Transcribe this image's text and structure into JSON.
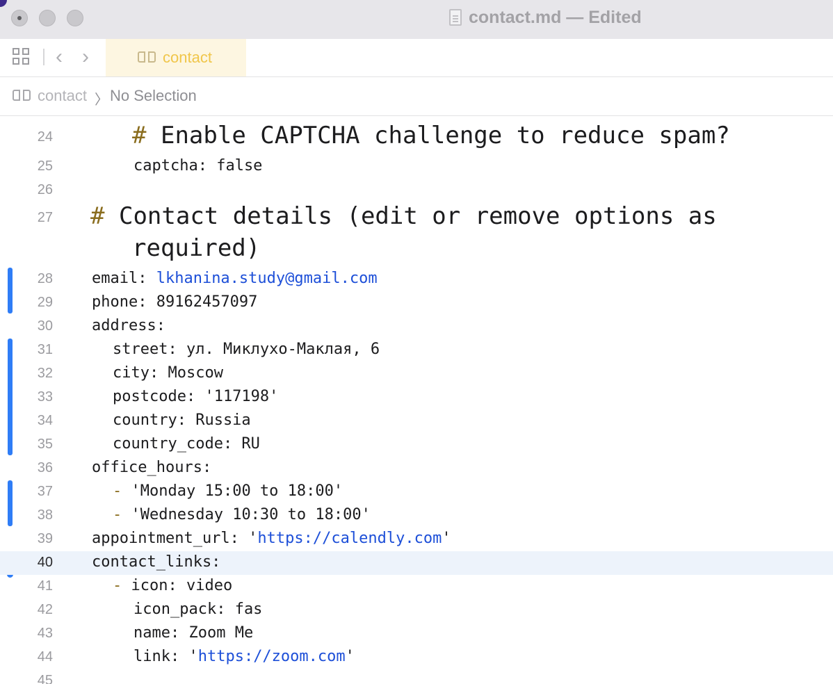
{
  "window": {
    "title": "contact.md — Edited",
    "controls": [
      "close",
      "minimize",
      "zoom"
    ]
  },
  "toolbar": {
    "tab_label": "contact",
    "tab_icon": "book-icon",
    "back_icon": "chevron-left-icon",
    "forward_icon": "chevron-right-icon",
    "layout_icon": "grid-icon"
  },
  "jumpbar": {
    "file": "contact",
    "separator": "〉",
    "selection": "No Selection"
  },
  "editor": {
    "lines": [
      {
        "num": "24",
        "text": "Enable CAPTCHA challenge to reduce spam?"
      },
      {
        "num": "25",
        "text": "captcha: false"
      },
      {
        "num": "26",
        "text": ""
      },
      {
        "num": "27",
        "text": "Contact details (edit or remove options as"
      },
      {
        "num": "",
        "text": "required)"
      },
      {
        "num": "28",
        "key": "email: ",
        "link": "lkhanina.study@gmail.com"
      },
      {
        "num": "29",
        "text": "phone: 89162457097"
      },
      {
        "num": "30",
        "text": "address:"
      },
      {
        "num": "31",
        "text": "street: ул. Миклухо-Маклая, 6"
      },
      {
        "num": "32",
        "text": "city: Moscow"
      },
      {
        "num": "33",
        "text": "postcode: '117198'"
      },
      {
        "num": "34",
        "text": "country: Russia"
      },
      {
        "num": "35",
        "text": "country_code: RU"
      },
      {
        "num": "36",
        "text": "office_hours:"
      },
      {
        "num": "37",
        "text": "'Monday 15:00 to 18:00'"
      },
      {
        "num": "38",
        "text": "'Wednesday 10:30 to 18:00'"
      },
      {
        "num": "39",
        "key": "appointment_url: '",
        "link": "https://calendly.com",
        "tail": "'"
      },
      {
        "num": "40",
        "text": "contact_links:"
      },
      {
        "num": "41",
        "text": "icon: video"
      },
      {
        "num": "42",
        "text": "icon_pack: fas"
      },
      {
        "num": "43",
        "text": "name: Zoom Me"
      },
      {
        "num": "44",
        "key": "link: '",
        "link": "https://zoom.com",
        "tail": "'"
      },
      {
        "num": "45",
        "text": ""
      }
    ],
    "hash_marker": "#",
    "dash_marker": "-",
    "current_line": "40"
  },
  "colors": {
    "change_bar": "#2f7df6",
    "link": "#1d4fd8",
    "markdown_marker": "#8a6d1e",
    "current_line_bg": "#edf3fb",
    "tab_active_bg": "#fdf6e1"
  }
}
